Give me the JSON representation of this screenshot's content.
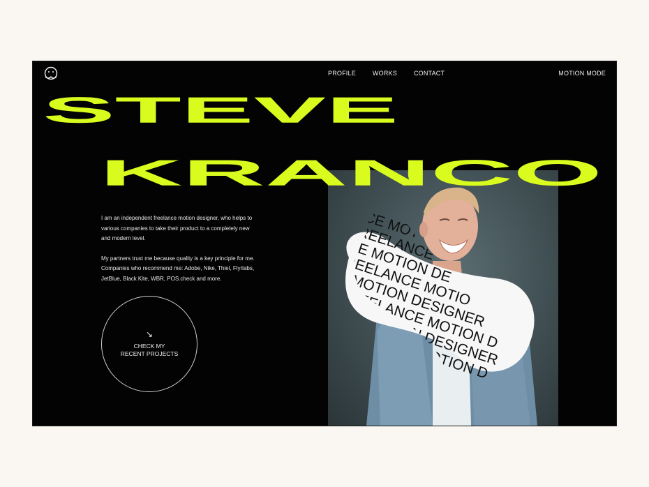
{
  "header": {
    "nav": [
      {
        "label": "PROFILE"
      },
      {
        "label": "WORKS"
      },
      {
        "label": "CONTACT"
      }
    ],
    "mode_label": "MOTION MODE"
  },
  "hero": {
    "first_name": "STEVE",
    "last_name": "KRANCO",
    "accent_color": "#d9fc1e"
  },
  "bio": {
    "paragraph_1": "I am an independent freelance motion designer, who helps to various companies to take their product to a completely new and modern level.",
    "paragraph_2": "My partners trust me because quality is a key principle for me. Companies who recommend me: Adobe, Nike, Thiel, Flyrlabs, JetBlue, Black Kite, WBR, POS.check and more."
  },
  "cta": {
    "arrow": "↘",
    "line1": "CHECK MY",
    "line2": "RECENT PROJECTS"
  },
  "sticker": {
    "lines": [
      "CE MOTIO",
      "FREELANCE",
      "CE MOTION DE",
      "FREELANCE MOTIO",
      "MOTION DESIGNER",
      "FREELANCE MOTION D",
      "CE MOTION DESIGNER",
      "FREELANCE MOTION D"
    ]
  }
}
